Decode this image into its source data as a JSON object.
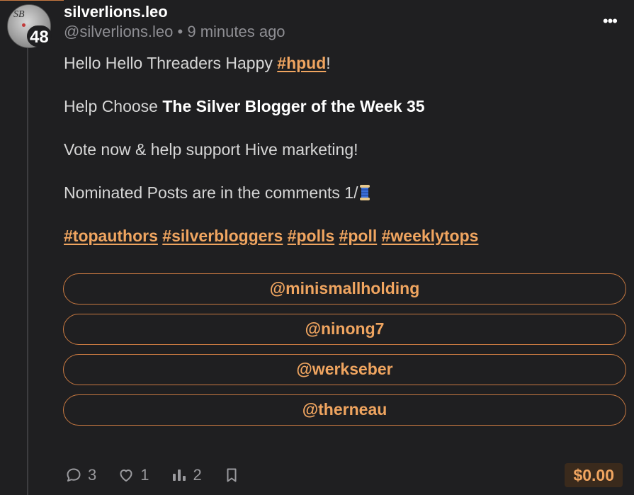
{
  "post": {
    "username": "silverlions.leo",
    "handle": "@silverlions.leo",
    "separator": "•",
    "time": "9 minutes ago",
    "avatar_badge": "48",
    "avatar_monogram": "SB",
    "more_label": "•••",
    "line1_prefix": "Hello Hello Threaders Happy ",
    "line1_tag": "#hpud",
    "line1_suffix": "!",
    "line2_prefix": "Help Choose ",
    "line2_strong": "The Silver Blogger of the Week 35",
    "line3": "Vote now & help support Hive marketing!",
    "line4": "Nominated Posts are in the comments 1/",
    "hashtags": [
      "#topauthors",
      "#silverbloggers",
      "#polls",
      "#poll",
      "#weeklytops"
    ]
  },
  "poll": {
    "options": [
      "@minismallholding",
      "@ninong7",
      "@werkseber",
      "@therneau"
    ]
  },
  "footer": {
    "comments": "3",
    "likes": "1",
    "votes": "2",
    "payout": "$0.00"
  },
  "colors": {
    "accent": "#f0a560",
    "border": "#c87941",
    "background": "#1f1f21"
  },
  "icons": [
    "comment-icon",
    "heart-icon",
    "bar-chart-icon",
    "bookmark-icon",
    "more-icon",
    "spool-icon"
  ]
}
